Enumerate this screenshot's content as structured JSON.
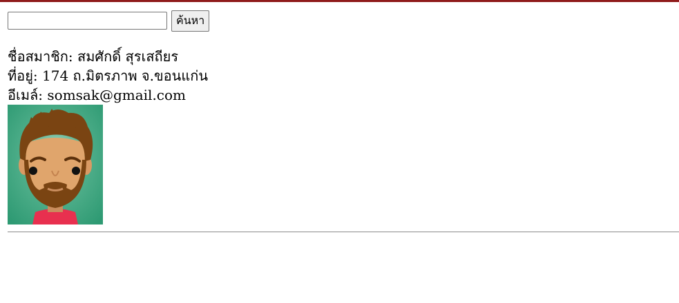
{
  "search": {
    "value": "",
    "placeholder": "",
    "button_label": "ค้นหา"
  },
  "member": {
    "name_label": "ชื่อสมาชิก:",
    "name_value": "สมศักดิ์ สุรเสถียร",
    "address_label": "ที่อยู่:",
    "address_value": "174 ถ.มิตรภาพ จ.ขอนแก่น",
    "email_label": "อีเมล์:",
    "email_value": "somsak@gmail.com"
  },
  "avatar": {
    "icon": "bearded-man-avatar",
    "background_color": "#2e9a73"
  },
  "colors": {
    "top_bar": "#8f1a1a"
  }
}
